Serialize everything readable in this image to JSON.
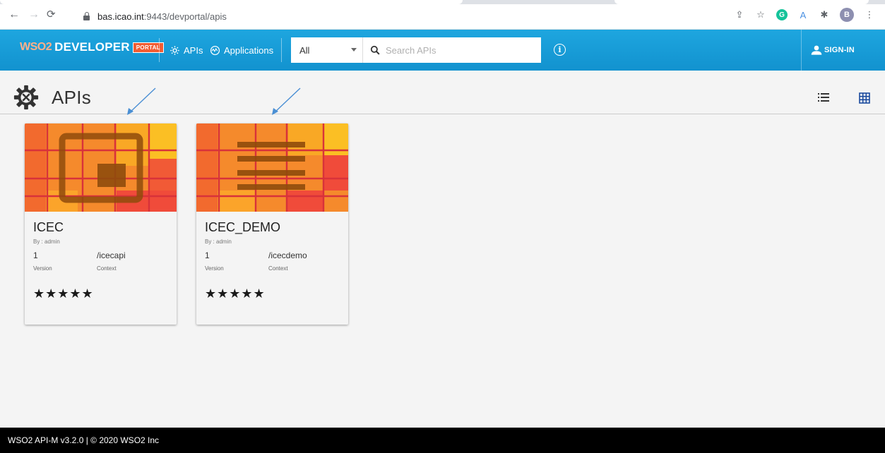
{
  "browser": {
    "url_host": "bas.icao.int",
    "url_rest": ":9443/devportal/apis",
    "profile_initial": "B"
  },
  "header": {
    "logo_wso2": "WSO2",
    "logo_developer": "DEVELOPER",
    "logo_portal": "PORTAL",
    "nav": {
      "apis": "APIs",
      "applications": "Applications"
    },
    "filter_value": "All",
    "search_placeholder": "Search APIs",
    "signin_label": "SIGN-IN"
  },
  "page": {
    "title": "APIs"
  },
  "cards": [
    {
      "name": "ICEC",
      "by": "By : admin",
      "version": "1",
      "context": "/icecapi",
      "version_label": "Version",
      "context_label": "Context",
      "rating": 5,
      "stars": "★★★★★"
    },
    {
      "name": "ICEC_DEMO",
      "by": "By : admin",
      "version": "1",
      "context": "/icecdemo",
      "version_label": "Version",
      "context_label": "Context",
      "rating": 5,
      "stars": "★★★★★"
    }
  ],
  "footer": {
    "text": "WSO2 API-M v3.2.0 | © 2020 WSO2 Inc"
  },
  "colors": {
    "appbar": "#1292cf",
    "thumb_orange": "#f5862c",
    "thumb_red": "#f04b3a",
    "thumb_yellow": "#fbb925",
    "grid_line": "#d8323a",
    "glyph": "#8a4a08"
  }
}
